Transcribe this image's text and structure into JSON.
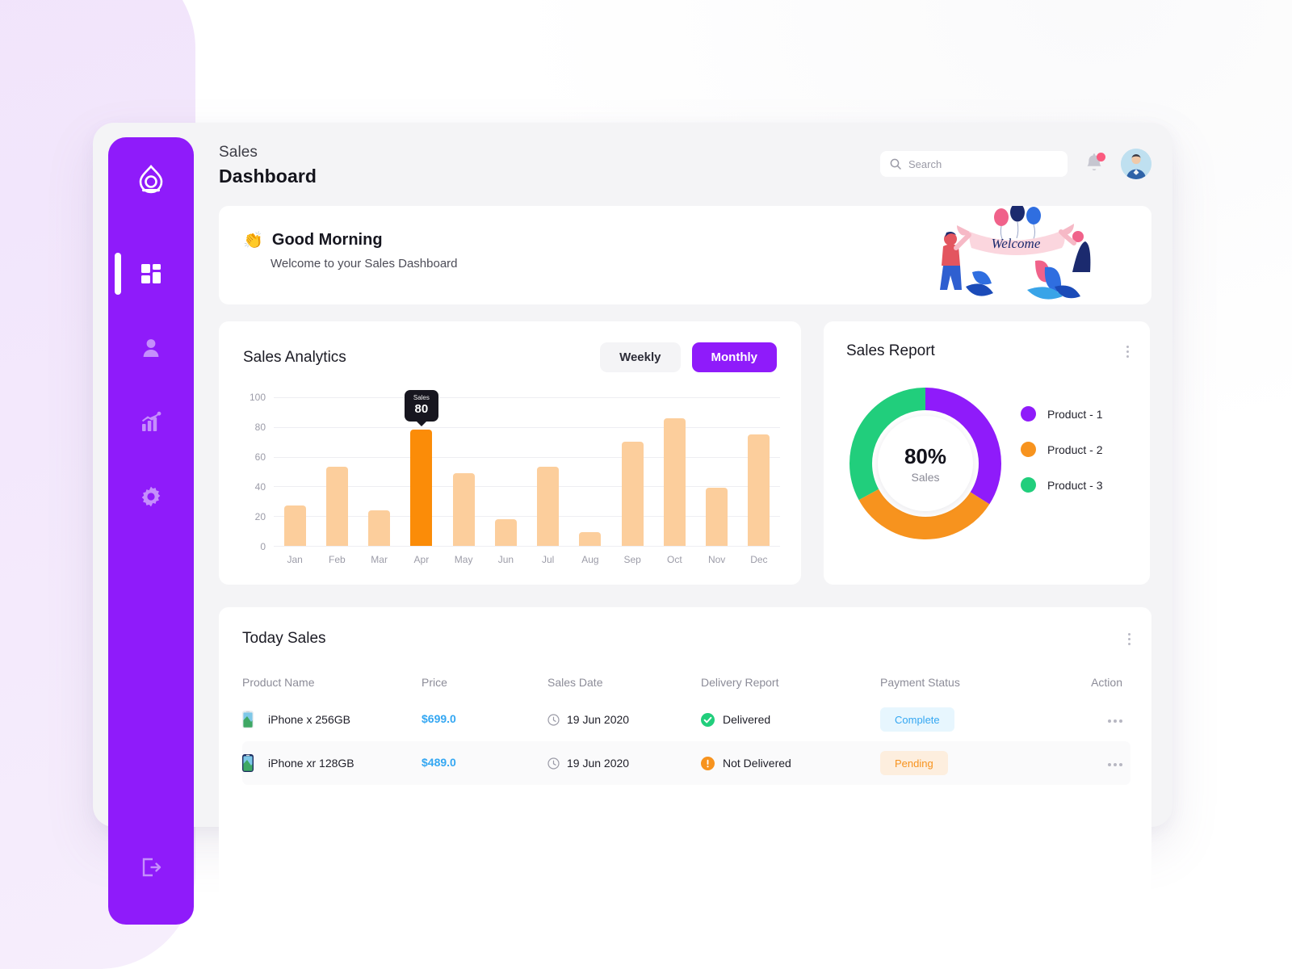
{
  "sidebar": {
    "logo_icon": "logo-diamond-icon",
    "items": [
      {
        "icon": "grid-dashboard-icon",
        "name": "dashboard",
        "active": true
      },
      {
        "icon": "user-icon",
        "name": "users",
        "active": false
      },
      {
        "icon": "bar-chart-icon",
        "name": "analytics",
        "active": false
      },
      {
        "icon": "gear-icon",
        "name": "settings",
        "active": false
      }
    ],
    "logout_icon": "logout-icon"
  },
  "header": {
    "eyebrow": "Sales",
    "title": "Dashboard",
    "search": {
      "placeholder": "Search",
      "value": "",
      "icon": "search-icon"
    },
    "bell_icon": "bell-icon",
    "has_notification": true,
    "avatar_icon": "avatar"
  },
  "welcome": {
    "emoji": "👏",
    "title": "Good Morning",
    "subtitle": "Welcome to your Sales Dashboard",
    "banner_text": "Welcome"
  },
  "analytics": {
    "title": "Sales Analytics",
    "toggle": {
      "weekly": "Weekly",
      "monthly": "Monthly",
      "selected": "Monthly"
    }
  },
  "report": {
    "title": "Sales Report",
    "center_value": "80%",
    "center_label": "Sales",
    "menu_icon": "kebab-menu-icon"
  },
  "today": {
    "title": "Today Sales",
    "menu_icon": "kebab-menu-icon",
    "columns": [
      "Product Name",
      "Price",
      "Sales Date",
      "Delivery Report",
      "Payment Status",
      "Action"
    ],
    "rows": [
      {
        "product": "iPhone x 256GB",
        "price": "$699.0",
        "date": "19 Jun 2020",
        "date_icon": "clock-icon",
        "delivery": "Delivered",
        "delivery_icon": "check-circle-icon",
        "delivery_color": "#21ce7c",
        "status": "Complete",
        "status_class": "complete",
        "action_icon": "ellipsis-icon",
        "phone_color": "#e8ecef"
      },
      {
        "product": "iPhone xr 128GB",
        "price": "$489.0",
        "date": "19 Jun 2020",
        "date_icon": "clock-icon",
        "delivery": "Not Delivered",
        "delivery_icon": "alert-circle-icon",
        "delivery_color": "#f7931e",
        "status": "Pending",
        "status_class": "pending",
        "action_icon": "ellipsis-icon",
        "phone_color": "#1b2a5e"
      }
    ]
  },
  "colors": {
    "brand_purple": "#8f1bfa",
    "bar": "#fcce9c",
    "bar_highlight": "#fb8c08",
    "green": "#21ce7c",
    "orange": "#f7931e",
    "blue": "#34a7f2",
    "notification": "#fb5b7f"
  },
  "chart_data": [
    {
      "type": "bar",
      "title": "Sales Analytics",
      "categories": [
        "Jan",
        "Feb",
        "Mar",
        "Apr",
        "May",
        "Jun",
        "Jul",
        "Aug",
        "Sep",
        "Oct",
        "Nov",
        "Dec"
      ],
      "values": [
        27,
        53,
        24,
        78,
        49,
        18,
        53,
        9,
        70,
        86,
        39,
        75
      ],
      "highlight_index": 3,
      "tooltip": {
        "label": "Sales",
        "value": "80",
        "category": "Apr"
      },
      "xlabel": "",
      "ylabel": "",
      "ylim": [
        0,
        100
      ],
      "yticks": [
        0,
        20,
        40,
        60,
        80,
        100
      ],
      "grid": true,
      "legend": "none"
    },
    {
      "type": "pie",
      "title": "Sales Report",
      "subtype": "donut",
      "center_value": "80%",
      "center_label": "Sales",
      "labels": [
        "Product - 1",
        "Product - 2",
        "Product - 3"
      ],
      "values": [
        34,
        33,
        33
      ],
      "colors": [
        "#8f1bfa",
        "#f7931e",
        "#21ce7c"
      ],
      "legend": "right"
    }
  ]
}
